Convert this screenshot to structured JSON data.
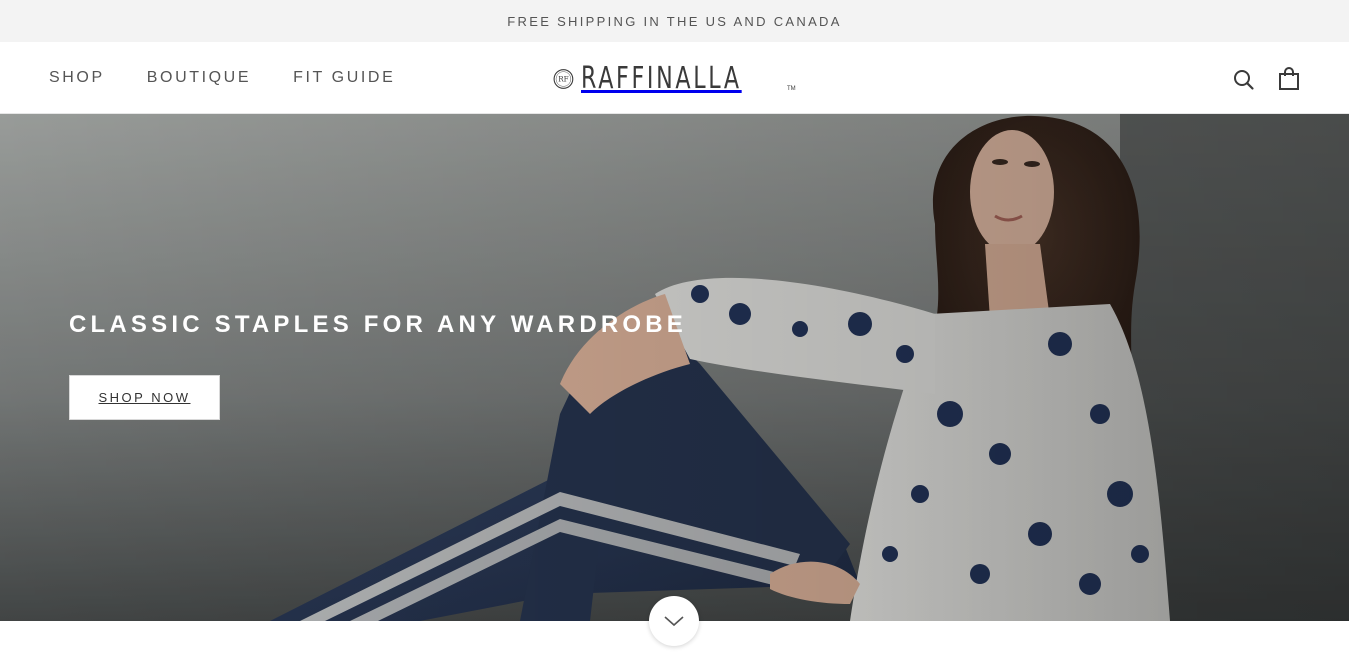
{
  "announcement": {
    "text": "FREE SHIPPING IN THE US AND CANADA"
  },
  "header": {
    "nav": [
      {
        "label": "SHOP"
      },
      {
        "label": "BOUTIQUE"
      },
      {
        "label": "FIT GUIDE"
      }
    ],
    "logo": {
      "text": "RAFFINALLA",
      "mark": "RF",
      "tm": "TM"
    },
    "icons": {
      "search": "search-icon",
      "cart": "shopping-bag-icon"
    }
  },
  "hero": {
    "title": "CLASSIC STAPLES FOR ANY WARDROBE",
    "cta_label": "SHOP NOW"
  },
  "scroll": {
    "icon": "chevron-down-icon"
  },
  "colors": {
    "announcement_bg": "#f3f3f3",
    "text": "#3a3a3a",
    "hero_text": "#ffffff",
    "denim": "#2b3a55"
  }
}
